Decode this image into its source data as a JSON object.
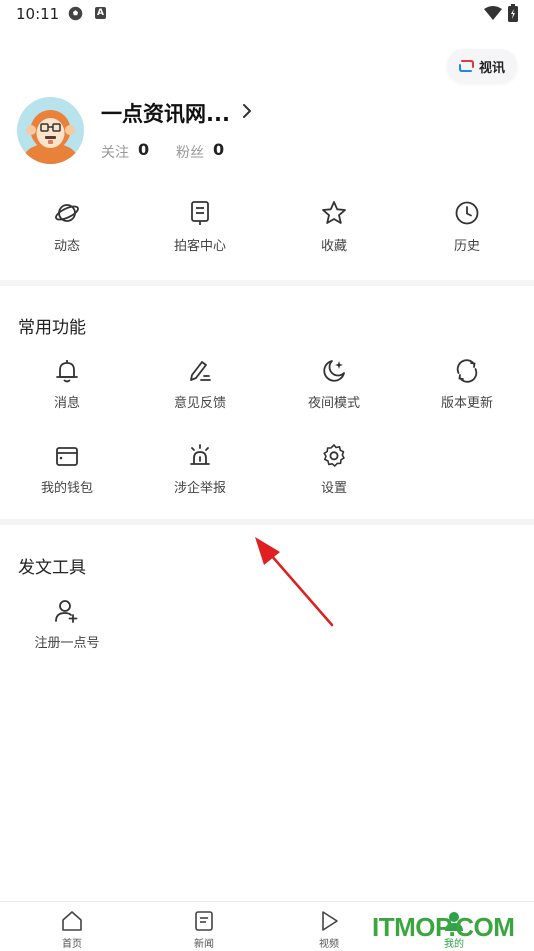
{
  "status_bar": {
    "time": "10:11",
    "badge_letter": "A"
  },
  "header": {
    "video_button_label": "视讯"
  },
  "profile": {
    "name": "一点资讯网...",
    "following_label": "关注",
    "following_count": "0",
    "fans_label": "粉丝",
    "fans_count": "0"
  },
  "quick_actions": [
    {
      "label": "动态",
      "icon": "planet-icon"
    },
    {
      "label": "拍客中心",
      "icon": "camera-book-icon"
    },
    {
      "label": "收藏",
      "icon": "star-icon"
    },
    {
      "label": "历史",
      "icon": "clock-icon"
    }
  ],
  "common_functions": {
    "title": "常用功能",
    "items": [
      {
        "label": "消息",
        "icon": "bell-icon"
      },
      {
        "label": "意见反馈",
        "icon": "pen-icon"
      },
      {
        "label": "夜间模式",
        "icon": "moon-icon"
      },
      {
        "label": "版本更新",
        "icon": "refresh-icon"
      },
      {
        "label": "我的钱包",
        "icon": "wallet-icon"
      },
      {
        "label": "涉企举报",
        "icon": "alarm-icon"
      },
      {
        "label": "设置",
        "icon": "gear-icon"
      }
    ]
  },
  "publish_tools": {
    "title": "发文工具",
    "items": [
      {
        "label": "注册一点号",
        "icon": "user-add-icon"
      }
    ]
  },
  "tab_bar": {
    "tabs": [
      {
        "label": "首页",
        "icon": "home-icon"
      },
      {
        "label": "新闻",
        "icon": "news-icon"
      },
      {
        "label": "视频",
        "icon": "play-icon"
      },
      {
        "label": "我的",
        "icon": "profile-icon"
      }
    ],
    "active_tab": "我的"
  },
  "watermark": {
    "text": "ITMOP.COM"
  },
  "colors": {
    "accent_green": "#2ea24a",
    "text_primary": "#222222",
    "text_secondary": "#999999",
    "arrow_red": "#e02020"
  }
}
